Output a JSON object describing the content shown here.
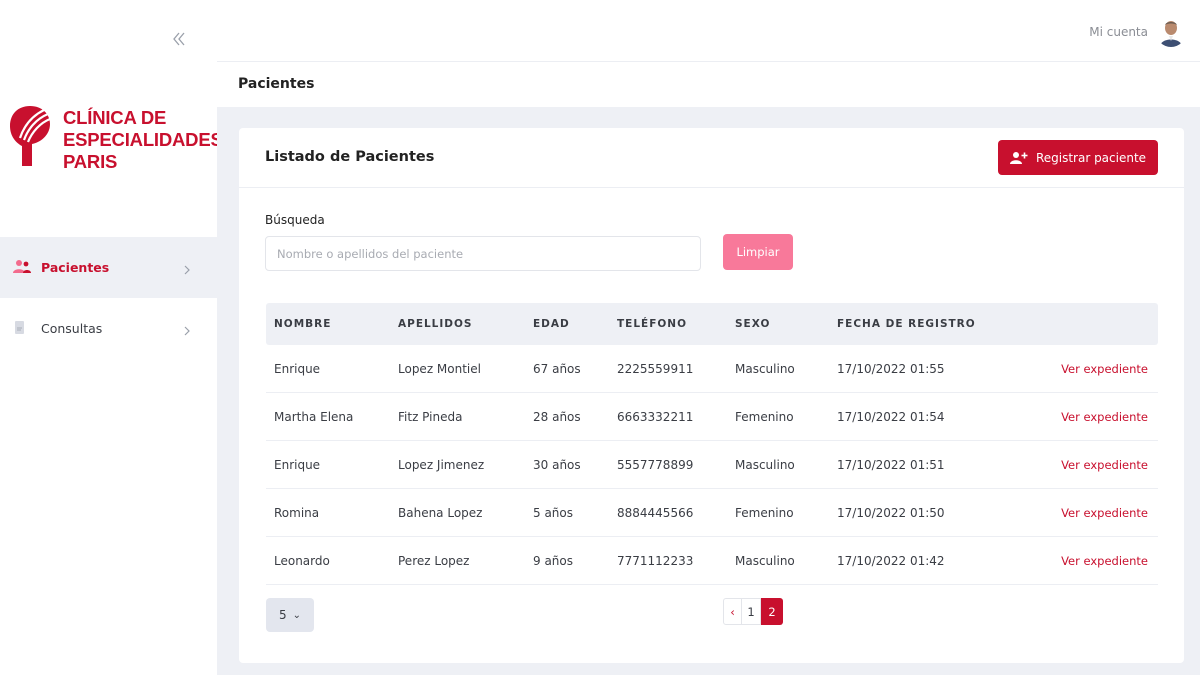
{
  "sidebar": {
    "logo_lines": [
      "CLÍNICA DE",
      "ESPECIALIDADES",
      "PARIS"
    ],
    "items": [
      {
        "label": "Pacientes",
        "icon": "users-icon"
      },
      {
        "label": "Consultas",
        "icon": "document-icon"
      }
    ]
  },
  "topbar": {
    "account_label": "Mi cuenta"
  },
  "page": {
    "title": "Pacientes"
  },
  "card": {
    "title": "Listado de Pacientes",
    "register_label": "Registrar paciente",
    "search_label": "Búsqueda",
    "search_placeholder": "Nombre o apellidos del paciente",
    "clear_label": "Limpiar"
  },
  "table": {
    "headers": [
      "NOMBRE",
      "APELLIDOS",
      "EDAD",
      "TELÉFONO",
      "SEXO",
      "FECHA DE REGISTRO"
    ],
    "action_label": "Ver expediente",
    "rows": [
      [
        "Enrique",
        "Lopez Montiel",
        "67 años",
        "2225559911",
        "Masculino",
        "17/10/2022 01:55"
      ],
      [
        "Martha Elena",
        "Fitz Pineda",
        "28 años",
        "6663332211",
        "Femenino",
        "17/10/2022 01:54"
      ],
      [
        "Enrique",
        "Lopez Jimenez",
        "30 años",
        "5557778899",
        "Masculino",
        "17/10/2022 01:51"
      ],
      [
        "Romina",
        "Bahena Lopez",
        "5 años",
        "8884445566",
        "Femenino",
        "17/10/2022 01:50"
      ],
      [
        "Leonardo",
        "Perez Lopez",
        "9 años",
        "7771112233",
        "Masculino",
        "17/10/2022 01:42"
      ]
    ]
  },
  "pagination": {
    "page_size": "5",
    "prev": "‹",
    "pages": [
      "1",
      "2"
    ],
    "current": "2"
  },
  "colors": {
    "brand": "#c8102e",
    "clear_button": "#f8799a",
    "background": "#eef0f5"
  }
}
